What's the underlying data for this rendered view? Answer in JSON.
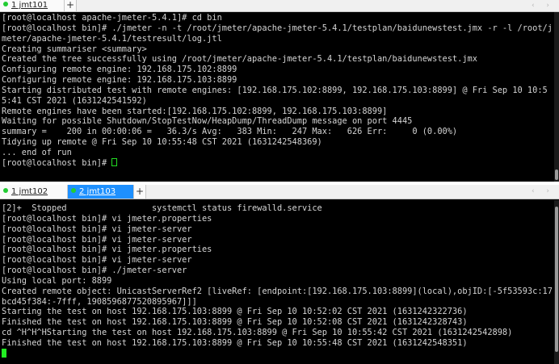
{
  "top_terminal": {
    "tabs": [
      {
        "label": "1 jmt101",
        "active": false
      }
    ],
    "add_tab_label": "+",
    "nav_arrows": "‹ ›",
    "lines": [
      "[root@localhost apache-jmeter-5.4.1]# cd bin",
      "[root@localhost bin]# ./jmeter -n -t /root/jmeter/apache-jmeter-5.4.1/testplan/baidunewstest.jmx -r -l /root/jmeter/apache-jmeter-5.4.1/testresult/log.jtl",
      "Creating summariser <summary>",
      "Created the tree successfully using /root/jmeter/apache-jmeter-5.4.1/testplan/baidunewstest.jmx",
      "Configuring remote engine: 192.168.175.102:8899",
      "Configuring remote engine: 192.168.175.103:8899",
      "Starting distributed test with remote engines: [192.168.175.102:8899, 192.168.175.103:8899] @ Fri Sep 10 10:55:41 CST 2021 (1631242541592)",
      "Remote engines have been started:[192.168.175.102:8899, 192.168.175.103:8899]",
      "Waiting for possible Shutdown/StopTestNow/HeapDump/ThreadDump message on port 4445",
      "summary =    200 in 00:00:06 =   36.3/s Avg:   383 Min:   247 Max:   626 Err:     0 (0.00%)",
      "Tidying up remote @ Fri Sep 10 10:55:48 CST 2021 (1631242548369)",
      "... end of run",
      "[root@localhost bin]# "
    ]
  },
  "bottom_terminal": {
    "tabs": [
      {
        "label": "1 jmt102",
        "active": false
      },
      {
        "label": "2 jmt103",
        "active": true
      }
    ],
    "add_tab_label": "+",
    "nav_arrows": "‹ ›",
    "lines": [
      "[2]+  Stopped                 systemctl status firewalld.service",
      "[root@localhost bin]# vi jmeter.properties",
      "[root@localhost bin]# vi jmeter-server",
      "[root@localhost bin]# vi jmeter-server",
      "[root@localhost bin]# vi jmeter.properties",
      "[root@localhost bin]# vi jmeter-server",
      "[root@localhost bin]# ./jmeter-server",
      "Using local port: 8899",
      "Created remote object: UnicastServerRef2 [liveRef: [endpoint:[192.168.175.103:8899](local),objID:[-5f53593c:17bcd45f384:-7fff, 1908596877520895967]]]",
      "Starting the test on host 192.168.175.103:8899 @ Fri Sep 10 10:52:02 CST 2021 (1631242322736)",
      "Finished the test on host 192.168.175.103:8899 @ Fri Sep 10 10:52:08 CST 2021 (1631242328743)",
      "cd ^H^H^HStarting the test on host 192.168.175.103:8899 @ Fri Sep 10 10:55:42 CST 2021 (1631242542898)",
      "Finished the test on host 192.168.175.103:8899 @ Fri Sep 10 10:55:48 CST 2021 (1631242548351)",
      ""
    ]
  },
  "colors": {
    "terminal_bg": "#000000",
    "terminal_fg": "#d4d4d4",
    "active_tab": "#1e90ff",
    "status_dot": "#22cc33",
    "cursor": "#22ee22"
  }
}
